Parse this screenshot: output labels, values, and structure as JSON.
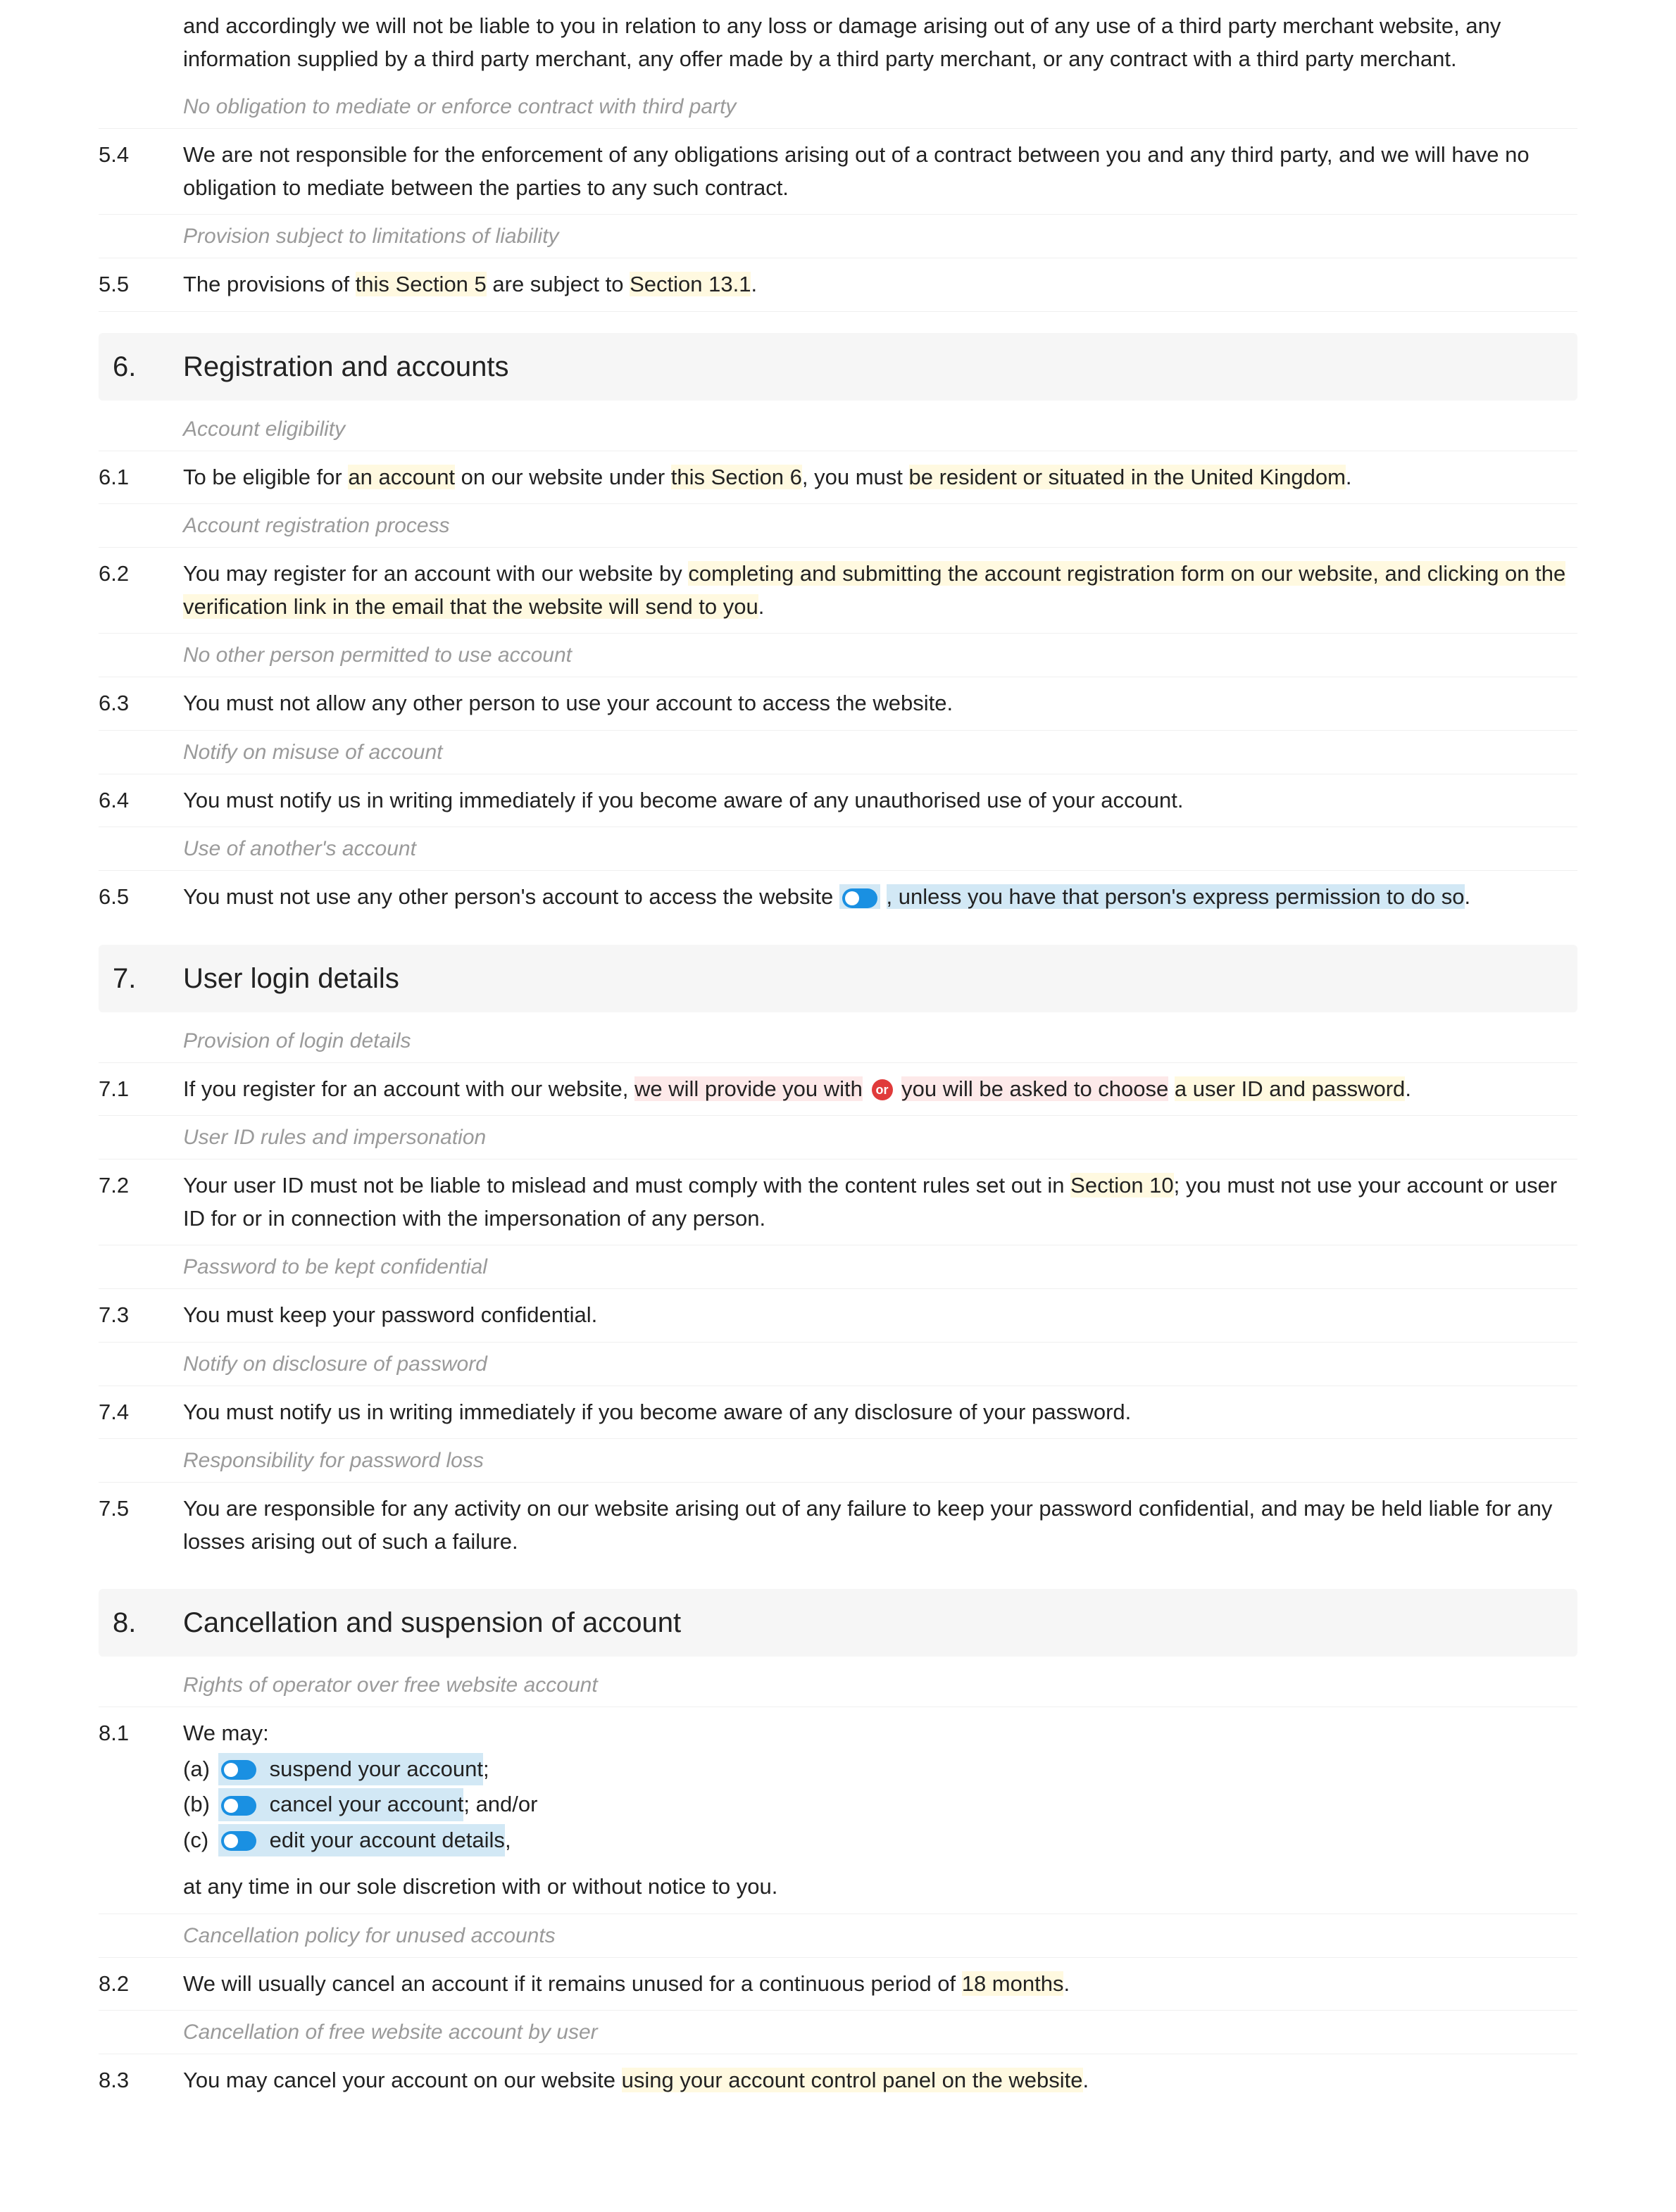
{
  "intro_continuation": "and accordingly we will not be liable to you in relation to any loss or damage arising out of any use of a third party merchant website, any information supplied by a third party merchant, any offer made by a third party merchant, or any contract with a third party merchant.",
  "note_5_4": "No obligation to mediate or enforce contract with third party",
  "c5_4_num": "5.4",
  "c5_4": "We are not responsible for the enforcement of any obligations arising out of a contract between you and any third party, and we will have no obligation to mediate between the parties to any such contract.",
  "note_5_5": "Provision subject to limitations of liability",
  "c5_5_num": "5.5",
  "c5_5_a": "The provisions of ",
  "c5_5_b": "this Section 5",
  "c5_5_c": " are subject to ",
  "c5_5_d": "Section 13.1",
  "c5_5_e": ".",
  "s6_num": "6.",
  "s6_title": "Registration and accounts",
  "note_6_1": "Account eligibility",
  "c6_1_num": "6.1",
  "c6_1_a": "To be eligible for ",
  "c6_1_b": "an account",
  "c6_1_c": " on our website under ",
  "c6_1_d": "this Section 6",
  "c6_1_e": ", you must ",
  "c6_1_f": "be resident or situated in the United Kingdom",
  "c6_1_g": ".",
  "note_6_2": "Account registration process",
  "c6_2_num": "6.2",
  "c6_2_a": "You may register for an account with our website by ",
  "c6_2_b": "completing and submitting the account registration form on our website, and clicking on the verification link in the email that the website will send to you",
  "c6_2_c": ".",
  "note_6_3": "No other person permitted to use account",
  "c6_3_num": "6.3",
  "c6_3": "You must not allow any other person to use your account to access the website.",
  "note_6_4": "Notify on misuse of account",
  "c6_4_num": "6.4",
  "c6_4": "You must notify us in writing immediately if you become aware of any unauthorised use of your account.",
  "note_6_5": "Use of another's account",
  "c6_5_num": "6.5",
  "c6_5_a": "You must not use any other person's account to access the website",
  "c6_5_b": ", unless you have that person's express permission to do so",
  "c6_5_c": ".",
  "s7_num": "7.",
  "s7_title": "User login details",
  "note_7_1": "Provision of login details",
  "c7_1_num": "7.1",
  "c7_1_a": "If you register for an account with our website, ",
  "c7_1_b": "we will provide you with",
  "c7_1_or": "or",
  "c7_1_c": "you will be asked to choose",
  "c7_1_d": " ",
  "c7_1_e": "a user ID and password",
  "c7_1_f": ".",
  "note_7_2": "User ID rules and impersonation",
  "c7_2_num": "7.2",
  "c7_2_a": "Your user ID must not be liable to mislead and must comply with the content rules set out in ",
  "c7_2_b": "Section 10",
  "c7_2_c": "; you must not use your account or user ID for or in connection with the impersonation of any person.",
  "note_7_3": "Password to be kept confidential",
  "c7_3_num": "7.3",
  "c7_3": "You must keep your password confidential.",
  "note_7_4": "Notify on disclosure of password",
  "c7_4_num": "7.4",
  "c7_4": "You must notify us in writing immediately if you become aware of any disclosure of your password.",
  "note_7_5": "Responsibility for password loss",
  "c7_5_num": "7.5",
  "c7_5": "You are responsible for any activity on our website arising out of any failure to keep your password confidential, and may be held liable for any losses arising out of such a failure.",
  "s8_num": "8.",
  "s8_title": "Cancellation and suspension of account",
  "note_8_1": "Rights of operator over free website account",
  "c8_1_num": "8.1",
  "c8_1_intro": "We may:",
  "c8_1_a_l": "(a)",
  "c8_1_a_t": "suspend your account",
  "c8_1_a_s": ";",
  "c8_1_b_l": "(b)",
  "c8_1_b_t": "cancel your account",
  "c8_1_b_s": "; and/or",
  "c8_1_c_l": "(c)",
  "c8_1_c_t": "edit your account details",
  "c8_1_c_s": ",",
  "c8_1_tail": "at any time in our sole discretion with or without notice to you.",
  "note_8_2": "Cancellation policy for unused accounts",
  "c8_2_num": "8.2",
  "c8_2_a": "We will usually cancel an account if it remains unused for a continuous period of ",
  "c8_2_b": "18 months",
  "c8_2_c": ".",
  "note_8_3": "Cancellation of free website account by user",
  "c8_3_num": "8.3",
  "c8_3_a": "You may cancel your account on our website ",
  "c8_3_b": "using your account control panel on the website",
  "c8_3_c": "."
}
